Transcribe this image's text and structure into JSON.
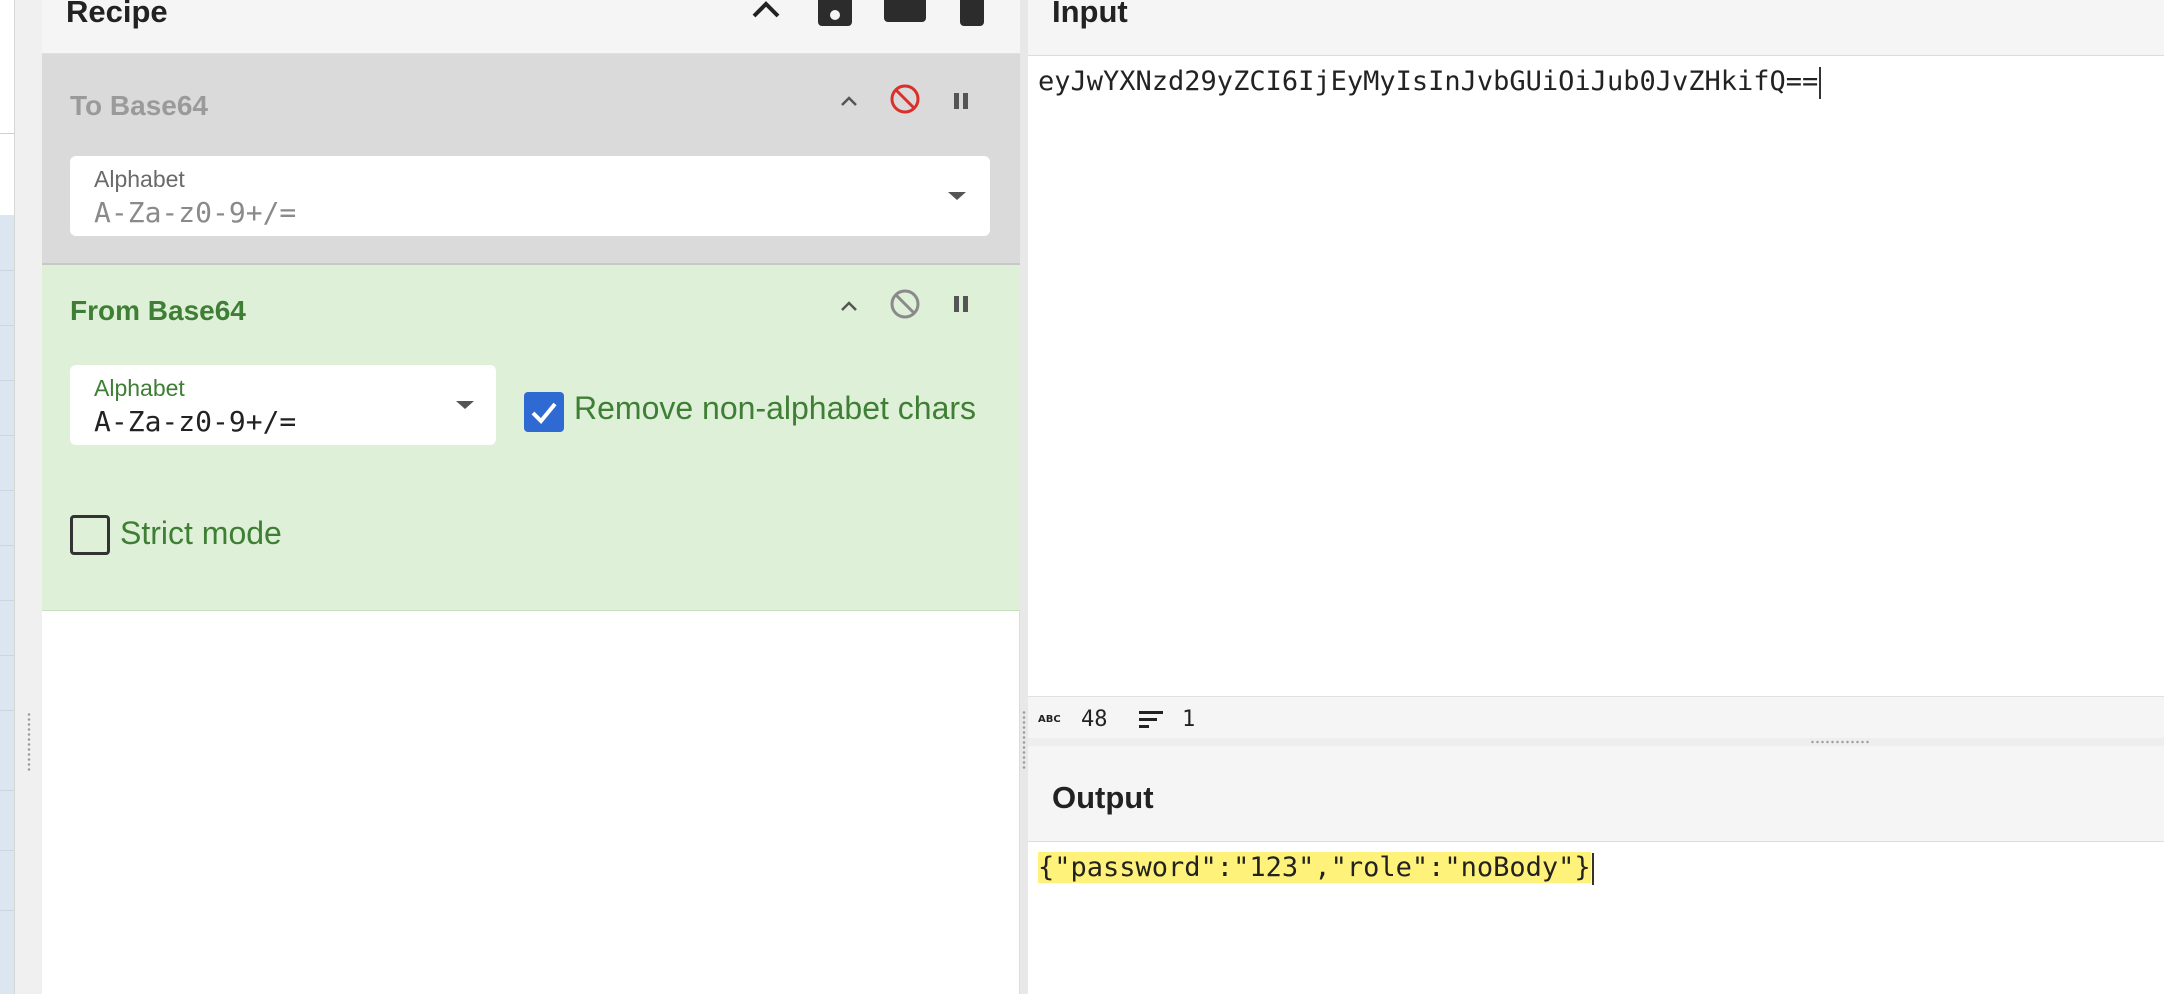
{
  "recipe": {
    "title": "Recipe",
    "operations": [
      {
        "name": "To Base64",
        "state": "disabled",
        "alphabet_label": "Alphabet",
        "alphabet_value": "A-Za-z0-9+/="
      },
      {
        "name": "From Base64",
        "state": "active",
        "alphabet_label": "Alphabet",
        "alphabet_value": "A-Za-z0-9+/=",
        "remove_non_alphabet_label": "Remove non-alphabet chars",
        "remove_non_alphabet_checked": true,
        "strict_mode_label": "Strict mode",
        "strict_mode_checked": false
      }
    ]
  },
  "input": {
    "title": "Input",
    "text": "eyJwYXNzd29yZCI6IjEyMyIsInJvbGUiOiJub0JvZHkifQ==",
    "char_count": "48",
    "line_count": "1"
  },
  "output": {
    "title": "Output",
    "text": "{\"password\":\"123\",\"role\":\"noBody\"}"
  },
  "icons": [
    "chevron-up-icon",
    "save-icon",
    "folder-icon",
    "trash-icon",
    "disable-icon",
    "pause-icon",
    "dropdown-arrow-icon",
    "checkmark-icon",
    "abc-icon",
    "lines-icon"
  ],
  "colors": {
    "active_op_bg": "#dff0d8",
    "active_op_text": "#3f7f35",
    "disabled_op_bg": "#dadada",
    "disable_active_red": "#d9302c",
    "checkbox_blue": "#2e6ad1",
    "output_highlight": "#fff27a"
  }
}
